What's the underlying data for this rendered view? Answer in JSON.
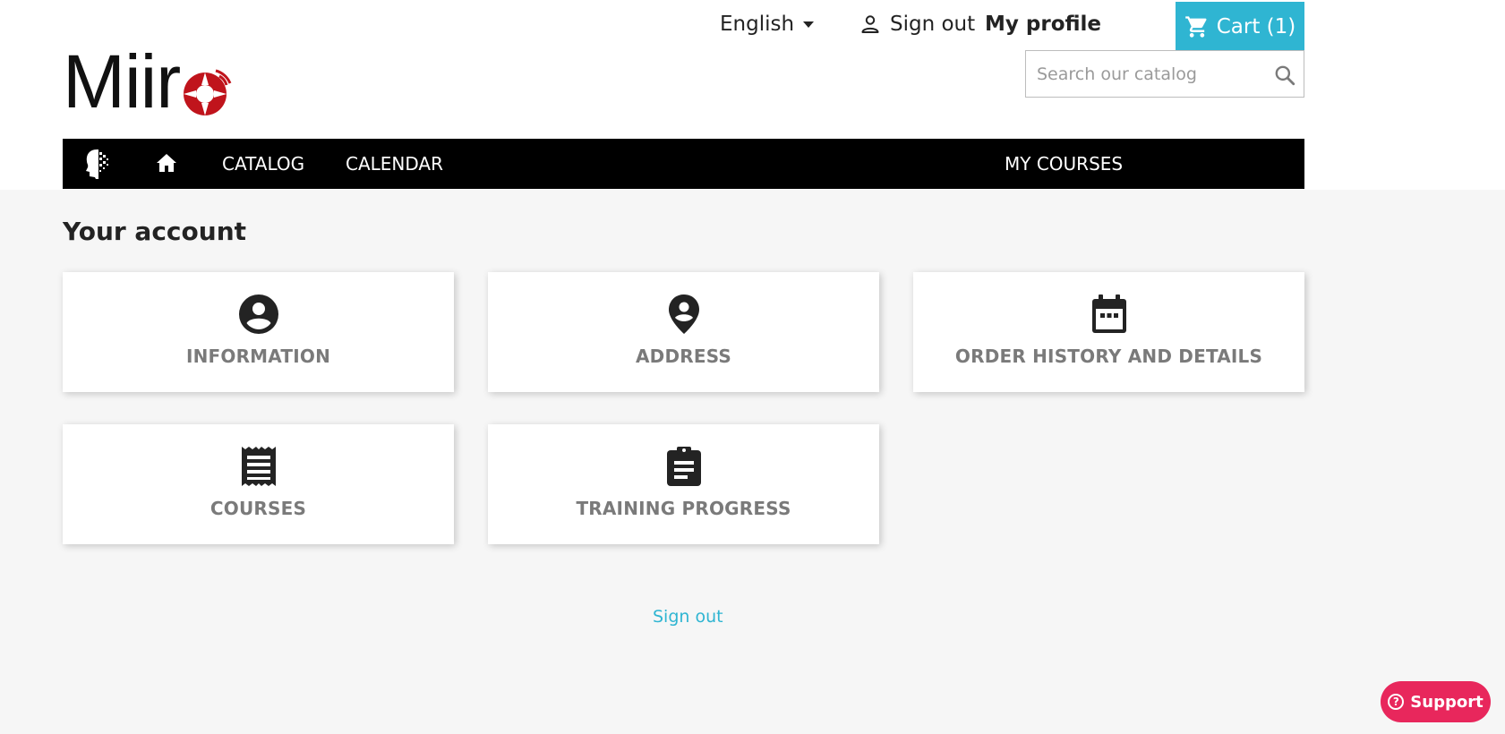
{
  "topbar": {
    "language": "English",
    "sign_out": "Sign out",
    "my_profile": "My profile",
    "cart": "Cart (1)"
  },
  "logo": {
    "text": "Miir"
  },
  "search": {
    "placeholder": "Search our catalog"
  },
  "nav": {
    "items": [
      "CATALOG",
      "CALENDAR",
      "MY COURSES"
    ]
  },
  "main": {
    "title": "Your account",
    "tiles": [
      {
        "label": "INFORMATION",
        "icon": "account-circle-icon"
      },
      {
        "label": "ADDRESS",
        "icon": "location-pin-icon"
      },
      {
        "label": "ORDER HISTORY AND DETAILS",
        "icon": "calendar-icon"
      },
      {
        "label": "COURSES",
        "icon": "receipt-icon"
      },
      {
        "label": "TRAINING PROGRESS",
        "icon": "clipboard-icon"
      }
    ],
    "sign_out": "Sign out"
  },
  "support": {
    "label": "Support"
  },
  "colors": {
    "accent": "#2fb5d2",
    "support": "#e8275c",
    "nav_bg": "#000000",
    "logo_red": "#c0141c"
  }
}
